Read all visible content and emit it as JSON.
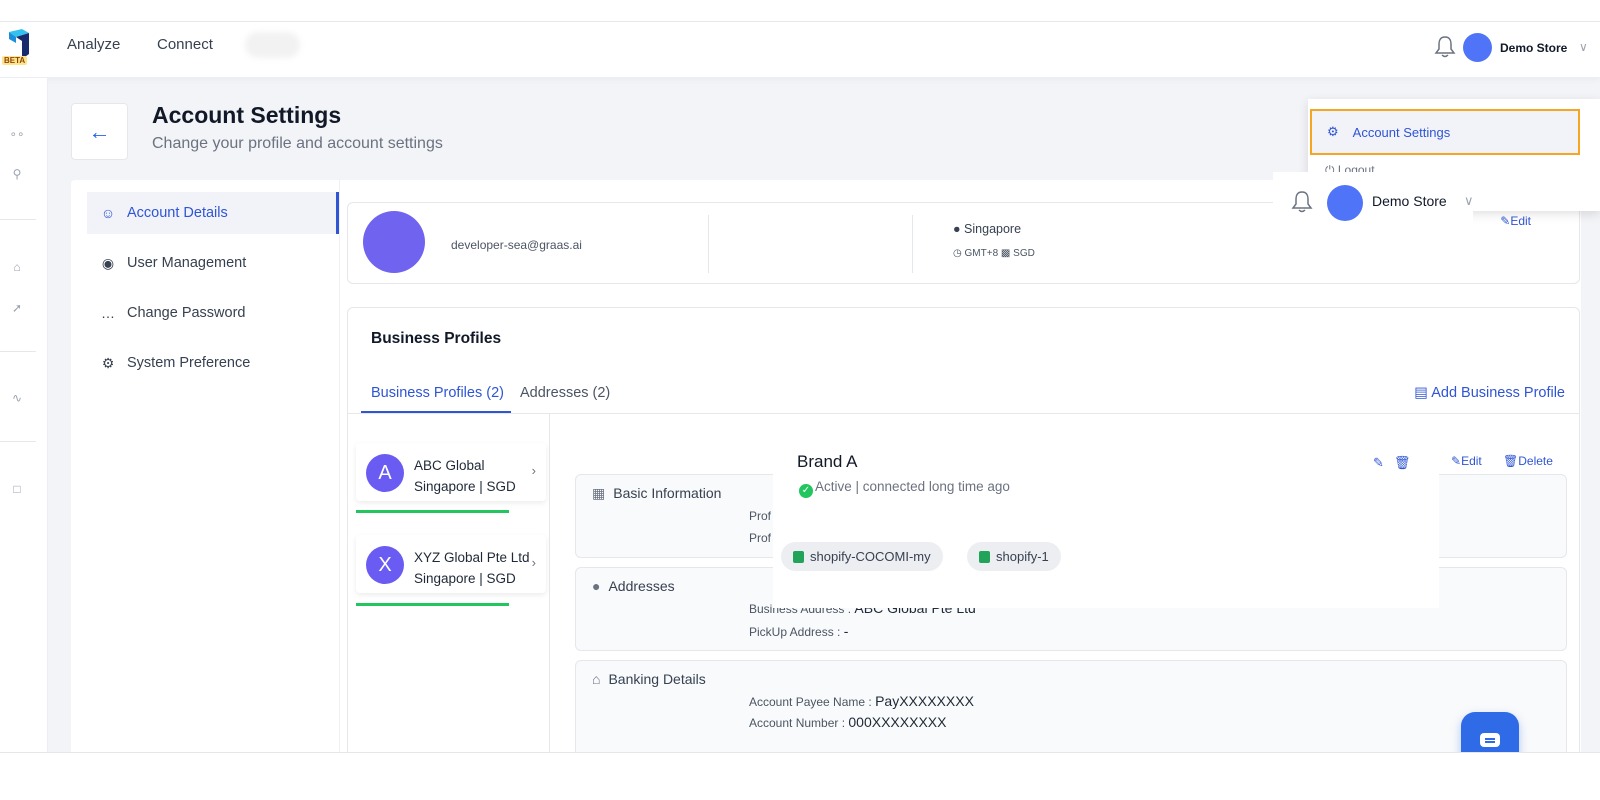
{
  "topbar": {
    "beta": "BETA",
    "nav": [
      "Analyze",
      "Connect"
    ],
    "store_name": "Demo Store"
  },
  "header": {
    "title": "Account Settings",
    "subtitle": "Change your profile and account settings"
  },
  "sidebar": {
    "items": [
      {
        "label": "Account Details",
        "icon": "user-group-icon"
      },
      {
        "label": "User Management",
        "icon": "user-manage-icon"
      },
      {
        "label": "Change Password",
        "icon": "password-dots-icon"
      },
      {
        "label": "System Preference",
        "icon": "gear-sparkle-icon"
      }
    ]
  },
  "profile": {
    "email": "developer-sea@graas.ai",
    "location": "Singapore",
    "timezone": "GMT+8",
    "currency": "SGD",
    "edit_label": "Edit"
  },
  "business": {
    "title": "Business Profiles",
    "tabs": [
      "Business Profiles (2)",
      "Addresses (2)"
    ],
    "add_label": "Add Business Profile",
    "profiles": [
      {
        "letter": "A",
        "name": "ABC Global",
        "region": "Singapore | SGD"
      },
      {
        "letter": "X",
        "name": "XYZ Global Pte Ltd",
        "region": "Singapore | SGD"
      }
    ],
    "edit_label": "Edit",
    "delete_label": "Delete",
    "sections": {
      "basic": {
        "title": "Basic Information",
        "row1": "Prof",
        "row2": "Prof"
      },
      "addresses": {
        "title": "Addresses",
        "business_label": "Business Address :",
        "business_value": "ABC Global Pte Ltd",
        "pickup_label": "PickUp Address :",
        "pickup_value": "-"
      },
      "banking": {
        "title": "Banking Details",
        "payee_label": "Account Payee Name :",
        "payee_value": "PayXXXXXXXX",
        "number_label": "Account Number :",
        "number_value": "000XXXXXXXX"
      }
    }
  },
  "brand_popup": {
    "name": "Brand A",
    "status": "Active",
    "connected": "connected long time ago",
    "chips": [
      "shopify-COCOMI-my",
      "shopify-1"
    ]
  },
  "dropdown": {
    "active_item": "Account Settings",
    "logout": "Logout"
  },
  "colors": {
    "accent": "#2f55d4",
    "avatar": "#4f74f7",
    "profile_avatar": "#7063f0",
    "highlight": "#f5a623",
    "success": "#22c55e"
  }
}
